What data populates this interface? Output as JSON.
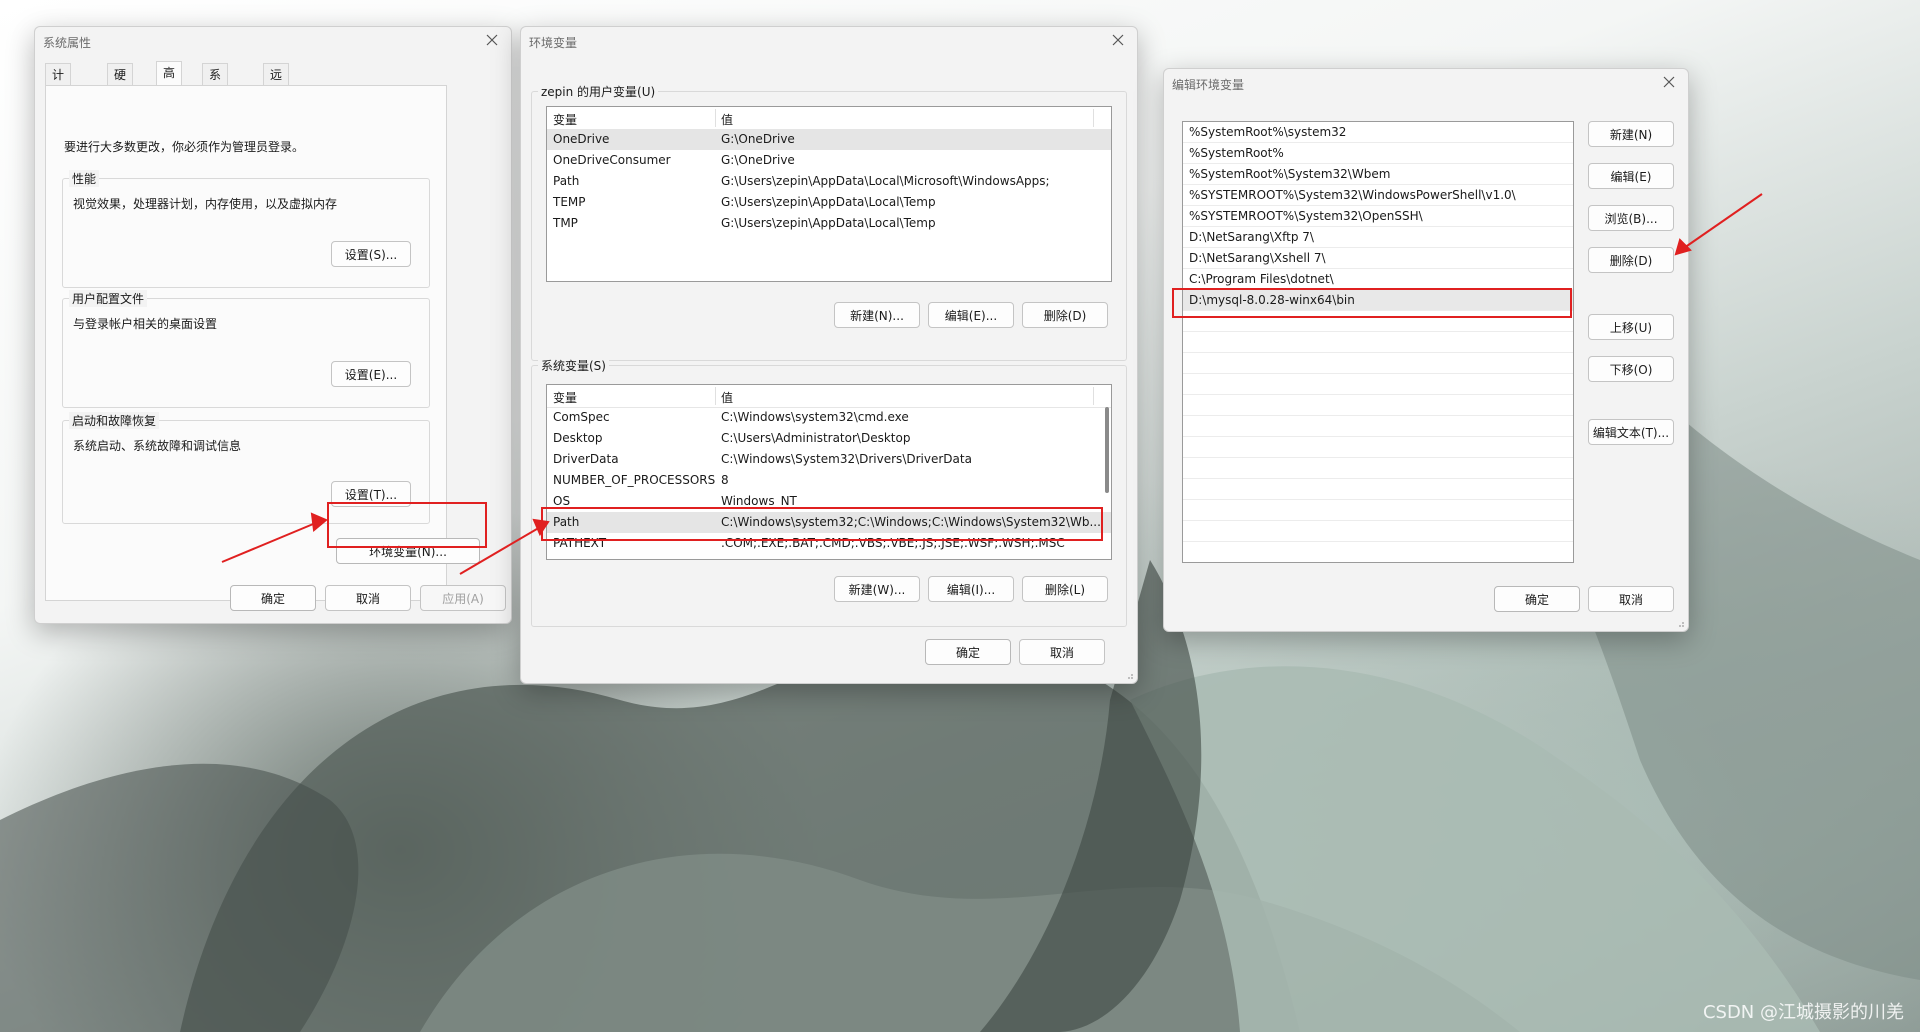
{
  "sys_props": {
    "title": "系统属性",
    "tabs": [
      "计算机名",
      "硬件",
      "高级",
      "系统保护",
      "远程"
    ],
    "active_tab": "高级",
    "admin_notice": "要进行大多数更改，你必须作为管理员登录。",
    "performance": {
      "legend": "性能",
      "desc": "视觉效果，处理器计划，内存使用，以及虚拟内存",
      "button": "设置(S)..."
    },
    "profiles": {
      "legend": "用户配置文件",
      "desc": "与登录帐户相关的桌面设置",
      "button": "设置(E)..."
    },
    "startup": {
      "legend": "启动和故障恢复",
      "desc": "系统启动、系统故障和调试信息",
      "button": "设置(T)..."
    },
    "env_button": "环境变量(N)...",
    "ok": "确定",
    "cancel": "取消",
    "apply": "应用(A)"
  },
  "env_vars": {
    "title": "环境变量",
    "user_section": "zepin 的用户变量(U)",
    "columns": [
      "变量",
      "值"
    ],
    "user_vars": [
      {
        "name": "OneDrive",
        "value": "G:\\OneDrive"
      },
      {
        "name": "OneDriveConsumer",
        "value": "G:\\OneDrive"
      },
      {
        "name": "Path",
        "value": "G:\\Users\\zepin\\AppData\\Local\\Microsoft\\WindowsApps;"
      },
      {
        "name": "TEMP",
        "value": "G:\\Users\\zepin\\AppData\\Local\\Temp"
      },
      {
        "name": "TMP",
        "value": "G:\\Users\\zepin\\AppData\\Local\\Temp"
      }
    ],
    "user_buttons": {
      "new": "新建(N)...",
      "edit": "编辑(E)...",
      "delete": "删除(D)"
    },
    "system_section": "系统变量(S)",
    "system_vars": [
      {
        "name": "ComSpec",
        "value": "C:\\Windows\\system32\\cmd.exe"
      },
      {
        "name": "Desktop",
        "value": "C:\\Users\\Administrator\\Desktop"
      },
      {
        "name": "DriverData",
        "value": "C:\\Windows\\System32\\Drivers\\DriverData"
      },
      {
        "name": "NUMBER_OF_PROCESSORS",
        "value": "8"
      },
      {
        "name": "OS",
        "value": "Windows_NT"
      },
      {
        "name": "Path",
        "value": "C:\\Windows\\system32;C:\\Windows;C:\\Windows\\System32\\Wb..."
      },
      {
        "name": "PATHEXT",
        "value": ".COM;.EXE;.BAT;.CMD;.VBS;.VBE;.JS;.JSE;.WSF;.WSH;.MSC"
      }
    ],
    "system_buttons": {
      "new": "新建(W)...",
      "edit": "编辑(I)...",
      "delete": "删除(L)"
    },
    "ok": "确定",
    "cancel": "取消"
  },
  "edit_env": {
    "title": "编辑环境变量",
    "entries": [
      "%SystemRoot%\\system32",
      "%SystemRoot%",
      "%SystemRoot%\\System32\\Wbem",
      "%SYSTEMROOT%\\System32\\WindowsPowerShell\\v1.0\\",
      "%SYSTEMROOT%\\System32\\OpenSSH\\",
      "D:\\NetSarang\\Xftp 7\\",
      "D:\\NetSarang\\Xshell 7\\",
      "C:\\Program Files\\dotnet\\",
      "D:\\mysql-8.0.28-winx64\\bin"
    ],
    "buttons": {
      "new": "新建(N)",
      "edit": "编辑(E)",
      "browse": "浏览(B)...",
      "delete": "删除(D)",
      "up": "上移(U)",
      "down": "下移(O)",
      "edit_text": "编辑文本(T)..."
    },
    "ok": "确定",
    "cancel": "取消"
  },
  "watermark": "CSDN @江城摄影的川羌",
  "colors": {
    "highlight": "#e02020",
    "window_bg": "#f3f3f3"
  }
}
